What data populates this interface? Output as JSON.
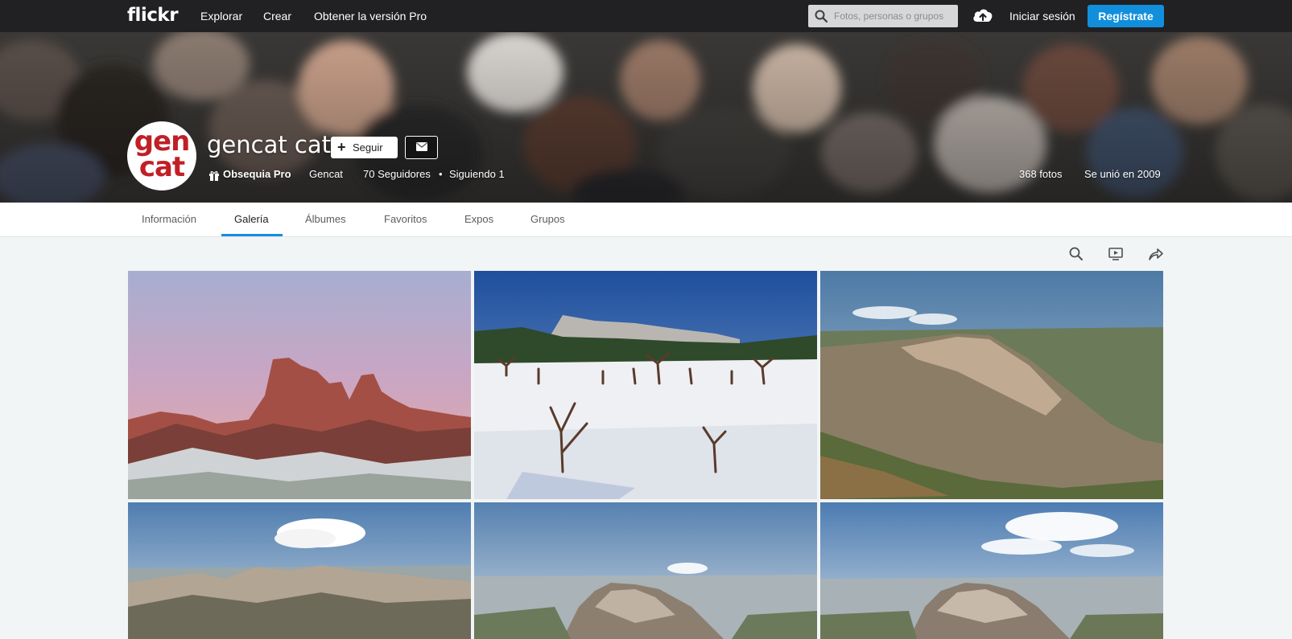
{
  "topbar": {
    "logo": "flickr",
    "nav": [
      "Explorar",
      "Crear",
      "Obtener la versión Pro"
    ],
    "search_placeholder": "Fotos, personas o grupos",
    "signin": "Iniciar sesión",
    "signup": "Regístrate"
  },
  "profile": {
    "avatar_line1": "gen",
    "avatar_line2": "cat",
    "name": "gencat cat",
    "follow_label": "Seguir",
    "gift_pro": "Obsequia Pro",
    "real_name": "Gencat",
    "followers": "70 Seguidores",
    "separator": "•",
    "following": "Siguiendo 1",
    "photos_count": "368 fotos",
    "joined": "Se unió en 2009"
  },
  "tabs": [
    "Información",
    "Galería",
    "Álbumes",
    "Favoritos",
    "Expos",
    "Grupos"
  ],
  "active_tab": "Galería",
  "colors": {
    "accent": "#128fdc",
    "topbar": "#212124",
    "avatar_red": "#c11f26"
  }
}
